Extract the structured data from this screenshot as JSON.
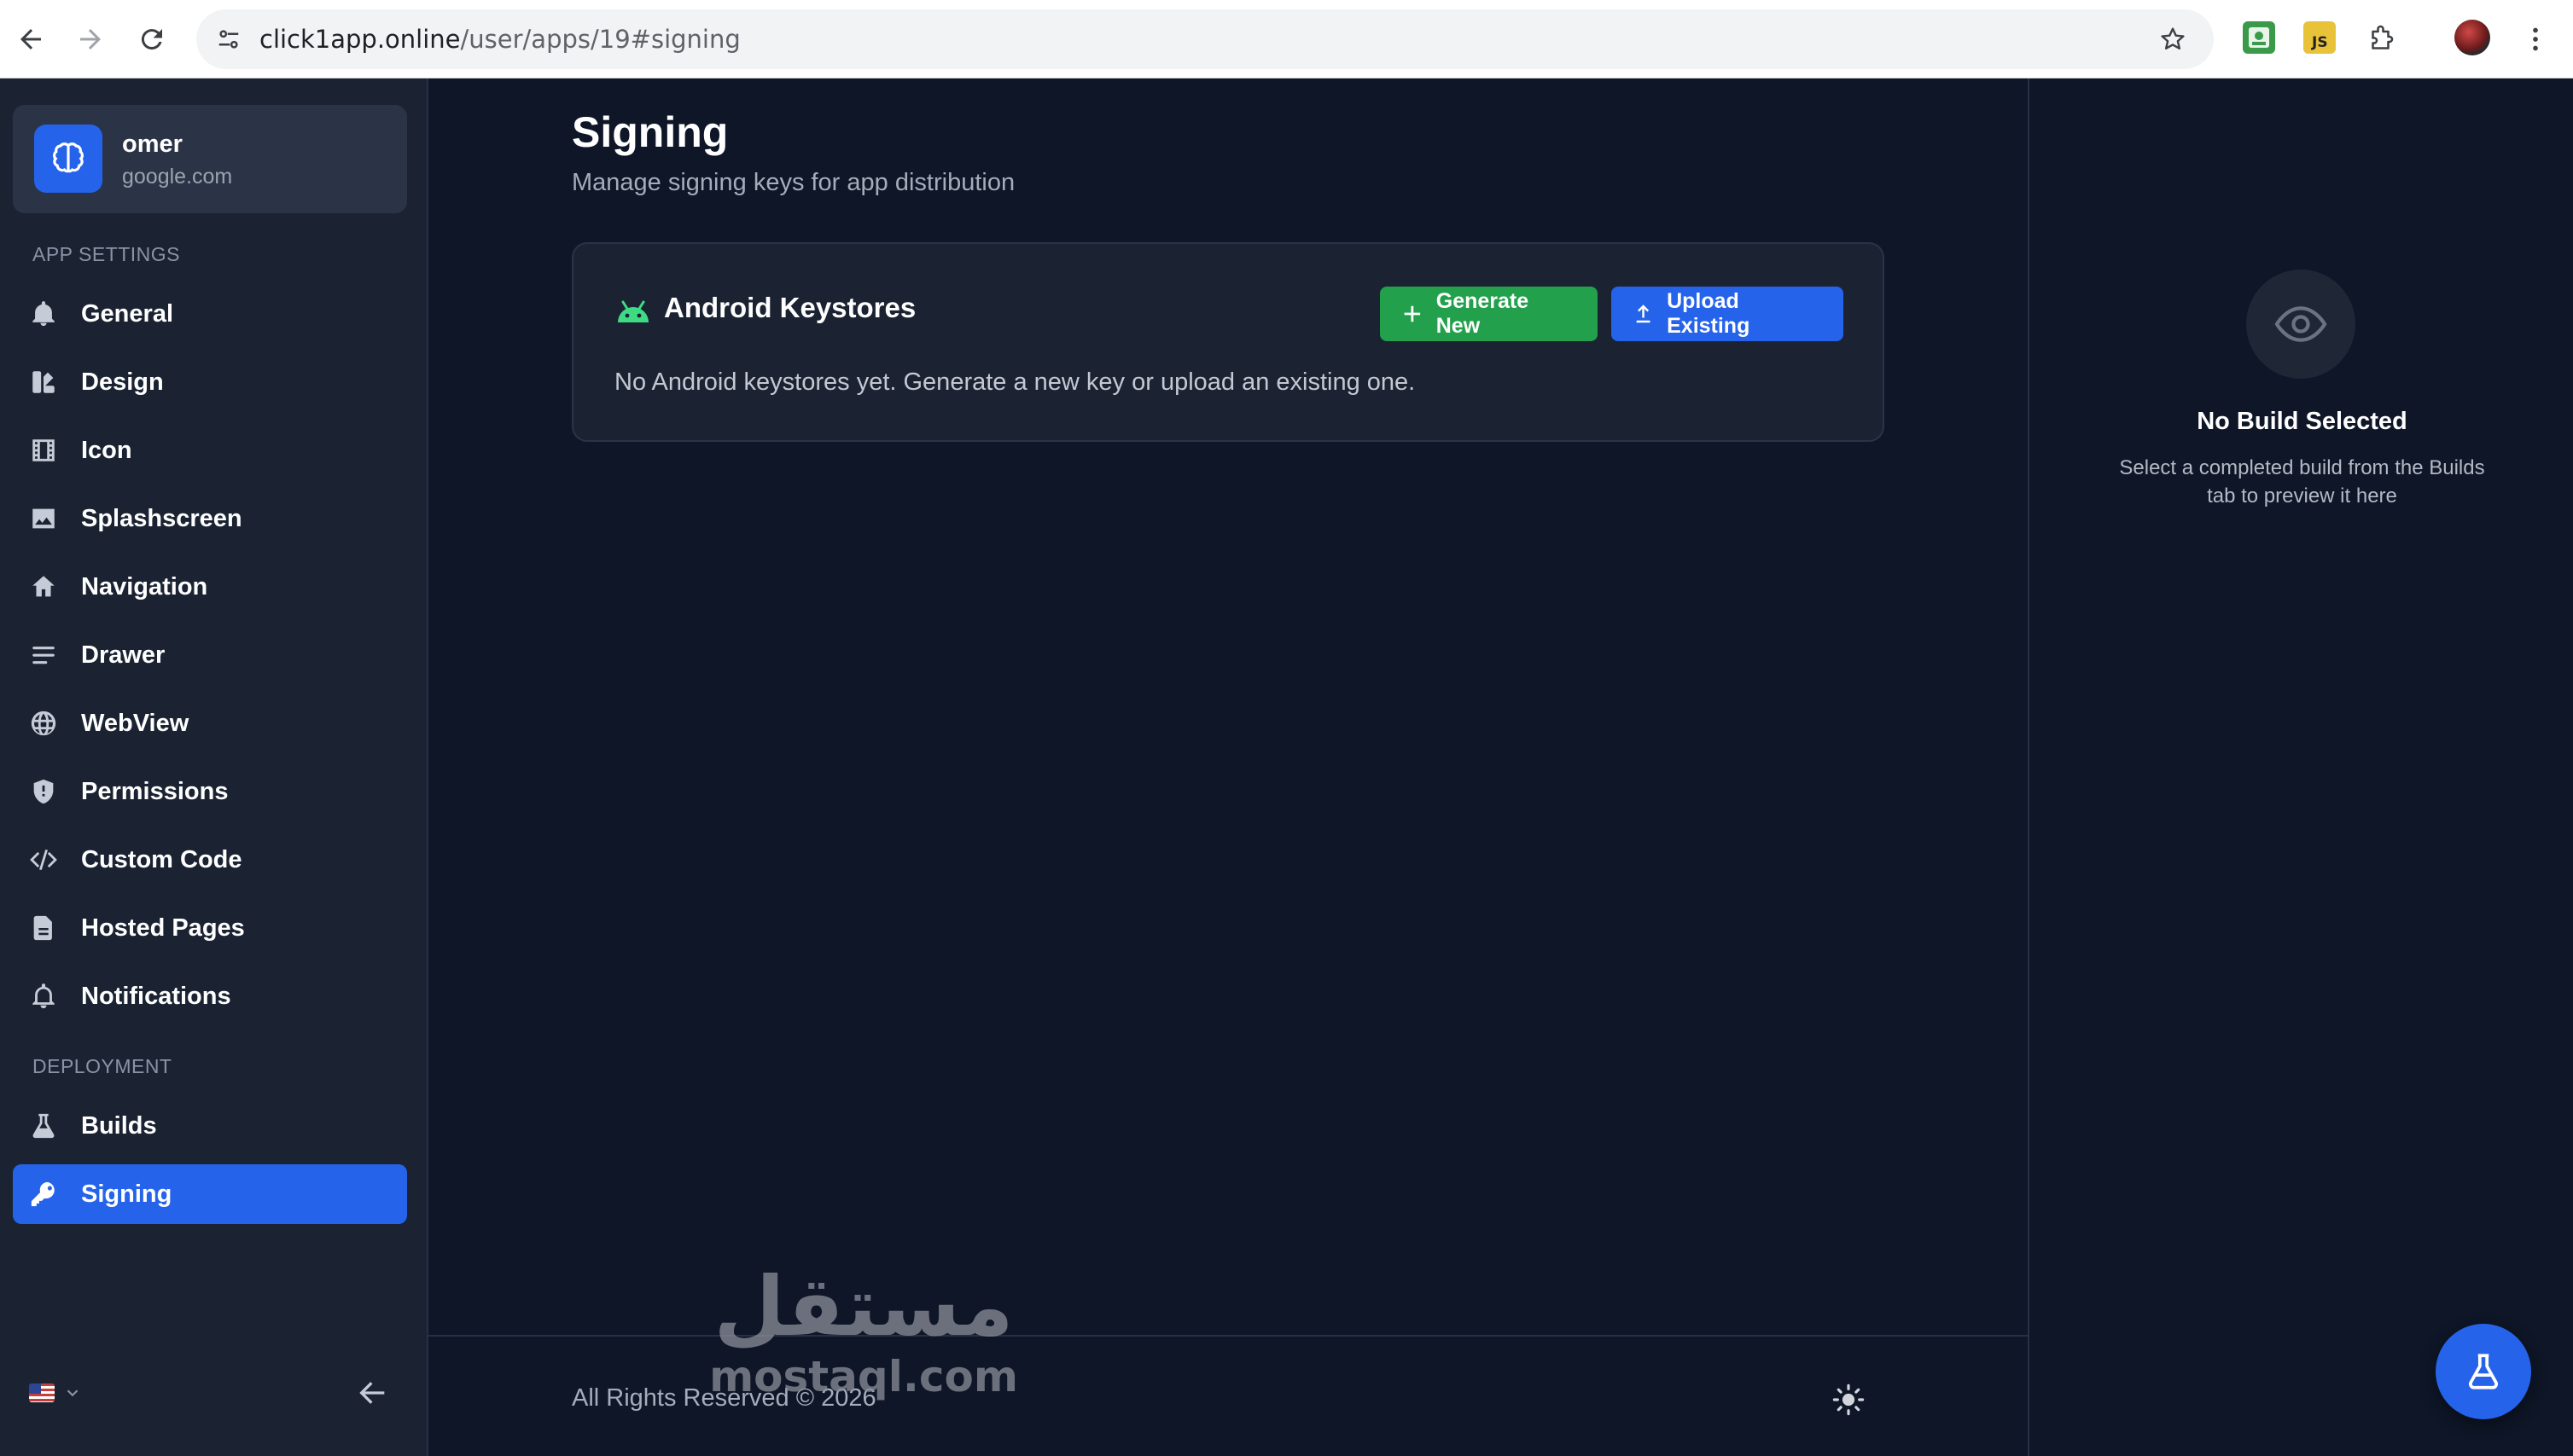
{
  "browser": {
    "url_host": "click1app.online",
    "url_path": "/user/apps/19#signing"
  },
  "account": {
    "name": "omer",
    "domain": "google.com"
  },
  "sidebar": {
    "app_settings_label": "APP SETTINGS",
    "deployment_label": "DEPLOYMENT",
    "app_settings_items": [
      {
        "label": "General",
        "icon": "bell-icon"
      },
      {
        "label": "Design",
        "icon": "palette-icon"
      },
      {
        "label": "Icon",
        "icon": "film-icon"
      },
      {
        "label": "Splashscreen",
        "icon": "image-icon"
      },
      {
        "label": "Navigation",
        "icon": "home-icon"
      },
      {
        "label": "Drawer",
        "icon": "lines-icon"
      },
      {
        "label": "WebView",
        "icon": "globe-icon"
      },
      {
        "label": "Permissions",
        "icon": "shield-icon"
      },
      {
        "label": "Custom Code",
        "icon": "code-icon"
      },
      {
        "label": "Hosted Pages",
        "icon": "document-icon"
      },
      {
        "label": "Notifications",
        "icon": "bell-outline-icon"
      }
    ],
    "deployment_items": [
      {
        "label": "Builds",
        "icon": "flask-icon"
      },
      {
        "label": "Signing",
        "icon": "key-icon",
        "active": true
      }
    ]
  },
  "main": {
    "title": "Signing",
    "subtitle": "Manage signing keys for app distribution",
    "card": {
      "title": "Android Keystores",
      "generate_label": "Generate New",
      "upload_label": "Upload Existing",
      "empty_message": "No Android keystores yet. Generate a new key or upload an existing one."
    },
    "footer": {
      "copyright": "All Rights Reserved © 2026"
    }
  },
  "watermark": {
    "arabic": "مستقل",
    "latin": "mostaql.com"
  },
  "preview": {
    "title": "No Build Selected",
    "description": "Select a completed build from the Builds tab to preview it here"
  },
  "colors": {
    "accent": "#2563eb",
    "success": "#22a04b",
    "background": "#0e1627",
    "sidebar": "#1b2333"
  }
}
